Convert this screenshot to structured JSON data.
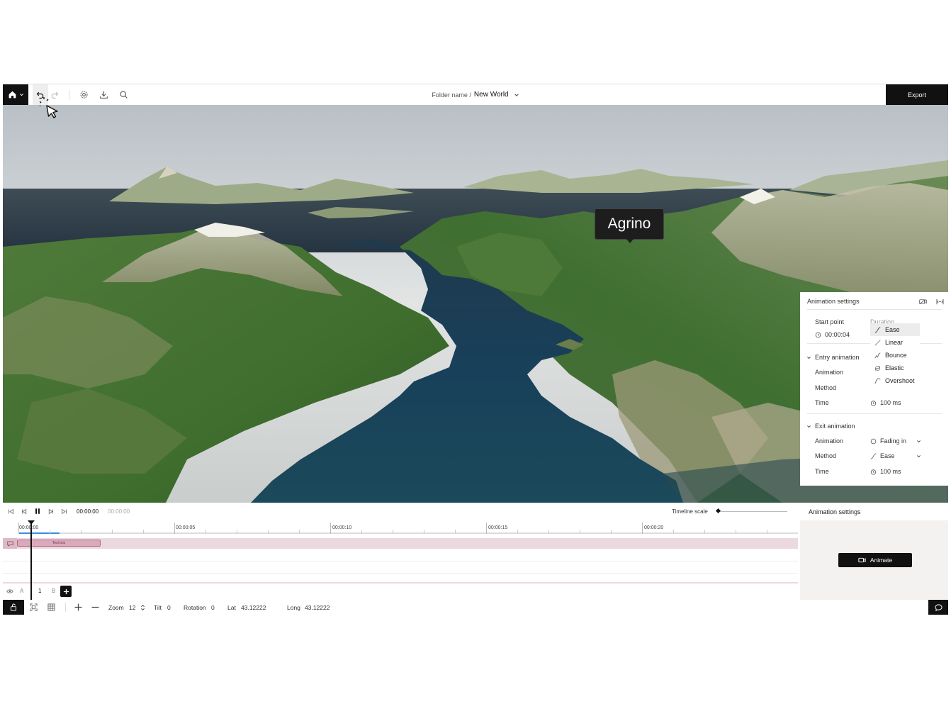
{
  "topbar": {
    "folder": "Folder name /",
    "title": "New World",
    "export_label": "Export"
  },
  "map": {
    "place_label": "Agrino"
  },
  "animation_panel": {
    "title": "Animation settings",
    "start_point_label": "Start point",
    "start_point_value": "00:00:04",
    "hidden_header": "Duration",
    "entry": {
      "title": "Entry animation",
      "animation_label": "Animation",
      "method_label": "Method",
      "time_label": "Time",
      "time_value": "100 ms"
    },
    "exit": {
      "title": "Exit animation",
      "animation_label": "Animation",
      "animation_value": "Fading in",
      "method_label": "Method",
      "method_value": "Ease",
      "time_label": "Time",
      "time_value": "100 ms"
    },
    "method_options": [
      "Ease",
      "Linear",
      "Bounce",
      "Elastic",
      "Overshoot"
    ],
    "selected_option": "Ease"
  },
  "timeline": {
    "current_time": "00:00:00",
    "total_time": "00:00:00",
    "scale_label": "Timeline scale",
    "scale_level": 0,
    "ticks": [
      "00:00:00",
      "00:00:05",
      "00:00:10",
      "00:00:15",
      "00:00:20"
    ],
    "clip_label": "Text box",
    "layer_a": "A",
    "layer_b": "B",
    "layer_number": "1"
  },
  "side_panel": {
    "title": "Animation settings",
    "animate_label": "Animate"
  },
  "status": {
    "zoom_label": "Zoom",
    "zoom_value": "12",
    "tilt_label": "Tilt",
    "tilt_value": "0",
    "rotation_label": "Rotation",
    "rotation_value": "0",
    "lat_label": "Lat",
    "lat_value": "43.12222",
    "long_label": "Long",
    "long_value": "43.12222"
  },
  "colors": {
    "dark": "#111111",
    "clip": "#e8c8d2",
    "clip_border": "#b06a86",
    "playhead": "#111111",
    "progress": "#3a8ee6"
  }
}
